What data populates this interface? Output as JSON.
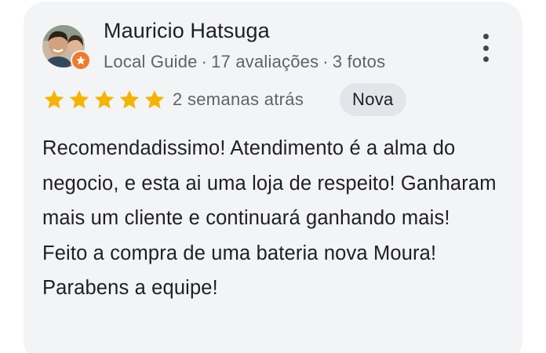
{
  "review": {
    "reviewer": {
      "name": "Mauricio Hatsuga",
      "badge": "Local Guide",
      "reviews_count": "17 avaliações",
      "photos_count": "3 fotos",
      "meta_separator": "·",
      "avatar_icon": "user-photo-avatar",
      "guide_badge_icon": "local-guide-star-badge"
    },
    "rating": {
      "value": 5,
      "max": 5,
      "star_color": "#f5b400"
    },
    "date": "2 semanas atrás",
    "new_label": "Nova",
    "text": "Recomendadissimo! Atendimento é a alma do negocio, e esta ai uma loja de respeito! Ganharam mais um cliente e continuará ganhando mais! Feito a compra de uma bateria nova Moura! Parabens a equipe!",
    "more_icon": "more-vert-icon"
  },
  "colors": {
    "card_background": "#f3f4f6",
    "primary_text": "#1f1f1f",
    "secondary_text": "#5f6368",
    "new_badge_background": "#e2e5e9",
    "local_guide_orange": "#f07a2a"
  }
}
